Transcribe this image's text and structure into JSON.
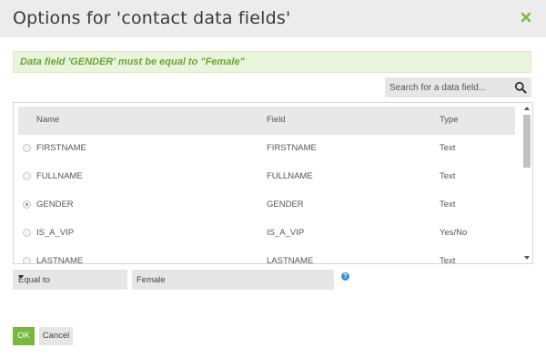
{
  "dialog": {
    "title": "Options for 'contact data fields'",
    "notice": "Data field 'GENDER' must be equal to \"Female\""
  },
  "search": {
    "placeholder": "Search for a data field..."
  },
  "table": {
    "headers": {
      "name": "Name",
      "field": "Field",
      "type": "Type"
    },
    "rows": [
      {
        "name": "FIRSTNAME",
        "field": "FIRSTNAME",
        "type": "Text",
        "selected": false
      },
      {
        "name": "FULLNAME",
        "field": "FULLNAME",
        "type": "Text",
        "selected": false
      },
      {
        "name": "GENDER",
        "field": "GENDER",
        "type": "Text",
        "selected": true
      },
      {
        "name": "IS_A_VIP",
        "field": "IS_A_VIP",
        "type": "Yes/No",
        "selected": false
      },
      {
        "name": "LASTNAME",
        "field": "LASTNAME",
        "type": "Text",
        "selected": false
      }
    ]
  },
  "condition": {
    "operator": "Equal to",
    "value": "Female",
    "help_glyph": "?"
  },
  "buttons": {
    "ok": "OK",
    "cancel": "Cancel"
  },
  "colors": {
    "accent": "#7ab83d",
    "notice_text": "#6aa532",
    "notice_bg": "#e8f5dc",
    "help": "#3d8fd6"
  },
  "icons": {
    "close": "close-icon",
    "search": "search-icon",
    "help": "help-icon",
    "dropdown": "chevron-down-icon"
  }
}
